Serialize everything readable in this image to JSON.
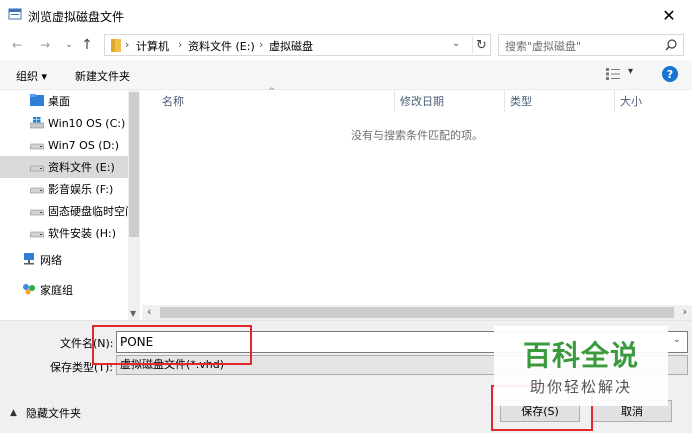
{
  "window": {
    "title": "浏览虚拟磁盘文件",
    "close_glyph": "✕"
  },
  "navigation": {
    "breadcrumb": [
      "计算机",
      "资料文件 (E:)",
      "虚拟磁盘"
    ],
    "search_placeholder": "搜索\"虚拟磁盘\""
  },
  "toolbar": {
    "organize_label": "组织 ▾",
    "new_folder_label": "新建文件夹",
    "help_label": "?"
  },
  "sidebar": {
    "items": [
      {
        "label": "桌面",
        "icon": "desktop-folder-icon"
      },
      {
        "label": "Win10 OS (C:)",
        "icon": "windows-drive-icon"
      },
      {
        "label": "Win7 OS (D:)",
        "icon": "drive-icon"
      },
      {
        "label": "资料文件 (E:)",
        "icon": "drive-icon",
        "selected": true
      },
      {
        "label": "影音娱乐 (F:)",
        "icon": "drive-icon"
      },
      {
        "label": "固态硬盘临时空间",
        "icon": "drive-icon"
      },
      {
        "label": "软件安装 (H:)",
        "icon": "drive-icon"
      },
      {
        "label": "网络",
        "icon": "network-icon"
      },
      {
        "label": "家庭组",
        "icon": "homegroup-icon"
      }
    ]
  },
  "file_list": {
    "columns": [
      "名称",
      "修改日期",
      "类型",
      "大小"
    ],
    "empty_message": "没有与搜索条件匹配的项。"
  },
  "footer": {
    "filename_label": "文件名(N):",
    "filename_value": "PONE",
    "filetype_label": "保存类型(T):",
    "filetype_value": "虚拟磁盘文件(*.vhd)",
    "hide_folders_label": "隐藏文件夹",
    "save_label": "保存(S)",
    "cancel_label": "取消"
  },
  "watermark": {
    "title": "百科全说",
    "subtitle": "助你轻松解决"
  },
  "colors": {
    "accent": "#1874d2",
    "highlight": "#e0282e",
    "watermark": "#3a9a3c"
  }
}
